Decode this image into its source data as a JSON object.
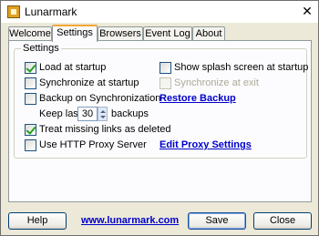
{
  "window": {
    "title": "Lunarmark"
  },
  "tabs": [
    "Welcome",
    "Settings",
    "Browsers",
    "Event Log",
    "About"
  ],
  "settings": {
    "group_title": "Settings",
    "load_at_startup": "Load at startup",
    "sync_at_startup": "Synchronize at startup",
    "backup_on_sync": "Backup on Synchronization",
    "keep_last": "Keep last",
    "keep_last_value": "30",
    "backups": "backups",
    "treat_missing": "Treat missing links as deleted",
    "use_proxy": "Use HTTP Proxy Server",
    "show_splash": "Show splash screen at startup",
    "sync_at_exit": "Synchronize at exit",
    "restore_backup": "Restore Backup",
    "edit_proxy": "Edit Proxy Settings"
  },
  "footer": {
    "help": "Help",
    "website": "www.lunarmark.com",
    "save": "Save",
    "close": "Close"
  }
}
